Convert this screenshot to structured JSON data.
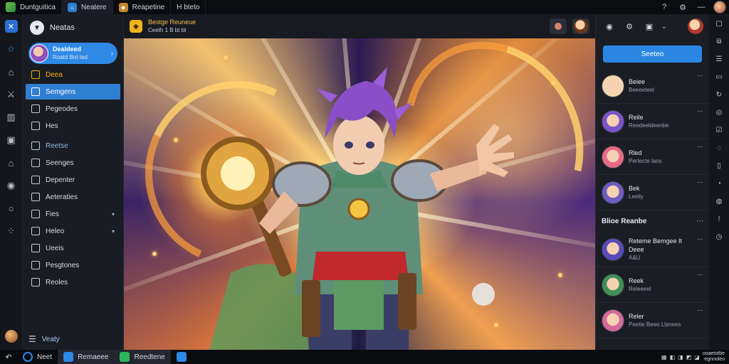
{
  "titlebar": {
    "tabs": [
      {
        "label": "Duntguitica",
        "icon": "app-logo-icon"
      },
      {
        "label": "Neatere",
        "icon": "home-icon"
      },
      {
        "label": "Reapetine",
        "icon": "game-icon"
      },
      {
        "label": "H bteto",
        "icon": "play-icon"
      }
    ],
    "controls": [
      "help-icon",
      "minimize-icon",
      "maximize-icon",
      "close-icon"
    ]
  },
  "leftnav": {
    "header_title": "Neatas",
    "profile": {
      "name": "Dealdeed",
      "sub": "Roatd Bot ted"
    },
    "items": [
      {
        "label": "Deea",
        "state": "highlight"
      },
      {
        "label": "Semgens",
        "state": "active"
      },
      {
        "label": "Pegeodes",
        "state": ""
      },
      {
        "label": "Hes",
        "state": ""
      },
      {
        "label": "Reetse",
        "state": "section"
      },
      {
        "label": "Seenges",
        "state": ""
      },
      {
        "label": "Depenter",
        "state": ""
      },
      {
        "label": "Aeteraties",
        "state": ""
      },
      {
        "label": "Fies",
        "state": "caret"
      },
      {
        "label": "Heleo",
        "state": "caret"
      },
      {
        "label": "Ueeis",
        "state": ""
      },
      {
        "label": "Pesgtones",
        "state": ""
      },
      {
        "label": "Reoles",
        "state": ""
      }
    ],
    "footer_label": "Veaty"
  },
  "main": {
    "game_title": "Bestge Reuneue",
    "game_sub": "Ceeth 1 B bt bt"
  },
  "rpanel": {
    "search_label": "Seeteo",
    "friends": [
      {
        "name": "Beiee",
        "status": "Beeeeteel",
        "color": "#f3d6b0"
      },
      {
        "name": "Reile",
        "status": "Reedeeldeenbe",
        "color": "#7a55c9"
      },
      {
        "name": "Rled",
        "status": "Pertecte lans",
        "color": "#e86a86"
      },
      {
        "name": "Bek",
        "status": "Leeliy",
        "color": "#6f5cc0"
      }
    ],
    "section_title": "Blioe Reanbe",
    "section_friends": [
      {
        "name": "Reteme Bemgee It",
        "name2": "Deee",
        "status": "A&U",
        "color": "#5a4bb8"
      },
      {
        "name": "Reek",
        "status": "Releeeel",
        "color": "#3f8f58"
      },
      {
        "name": "Reler",
        "status": "Peetie Beeo Llsnees",
        "color": "#d36a9a"
      }
    ]
  },
  "taskbar": {
    "items": [
      {
        "label": "Neet",
        "color": "#2d88e6"
      },
      {
        "label": "Remaeee",
        "color": "#2d88e6"
      },
      {
        "label": "Reedtene",
        "color": "#2fb35a"
      }
    ],
    "clock_line1": "ooaetotbe",
    "clock_line2": "egnnoleo"
  }
}
